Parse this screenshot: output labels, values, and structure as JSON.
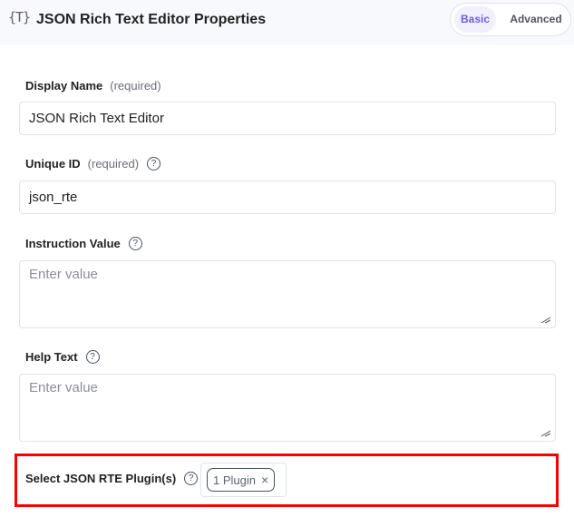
{
  "header": {
    "icon": "{T}",
    "title": "JSON Rich Text Editor Properties",
    "tabs": [
      {
        "label": "Basic",
        "active": true
      },
      {
        "label": "Advanced",
        "active": false
      }
    ]
  },
  "fields": {
    "display_name": {
      "label": "Display Name",
      "required": "(required)",
      "value": "JSON Rich Text Editor"
    },
    "unique_id": {
      "label": "Unique ID",
      "required": "(required)",
      "value": "json_rte"
    },
    "instruction_value": {
      "label": "Instruction Value",
      "placeholder": "Enter value",
      "value": ""
    },
    "help_text": {
      "label": "Help Text",
      "placeholder": "Enter value",
      "value": ""
    },
    "plugins": {
      "label": "Select JSON RTE Plugin(s)",
      "chip": "1 Plugin",
      "chip_close": "×"
    }
  },
  "help_glyph": "?",
  "colors": {
    "accent": "#6c5ce7",
    "highlight": "#ff0000",
    "border": "#dde3ee",
    "header_bg": "#f7f9fc"
  }
}
